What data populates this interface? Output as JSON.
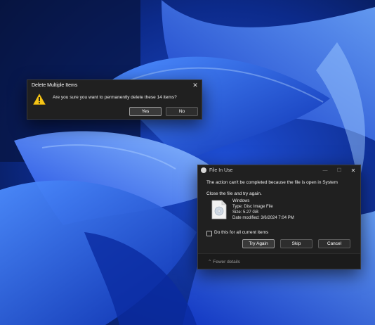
{
  "delete_dialog": {
    "title": "Delete Multiple Items",
    "close_label": "✕",
    "message": "Are you sure you want to permanently delete these 14 items?",
    "yes_label": "Yes",
    "no_label": "No"
  },
  "file_in_use_dialog": {
    "title": "File In Use",
    "minimize_label": "—",
    "maximize_label": "☐",
    "close_label": "✕",
    "message": "The action can't be completed because the file is open in System",
    "instruction": "Close the file and try again.",
    "file": {
      "name": "Windows",
      "type": "Type: Disc Image File",
      "size": "Size: 5.27 GB",
      "modified": "Date modified: 3/6/2024 7:04 PM"
    },
    "checkbox_label": "Do this for all current items",
    "try_again_label": "Try Again",
    "skip_label": "Skip",
    "cancel_label": "Cancel",
    "fewer_details_label": "Fewer details"
  },
  "colors": {
    "dialog_bg": "#202020",
    "accent_warning": "#f5c518",
    "wallpaper_blue": "#2a5cff"
  }
}
